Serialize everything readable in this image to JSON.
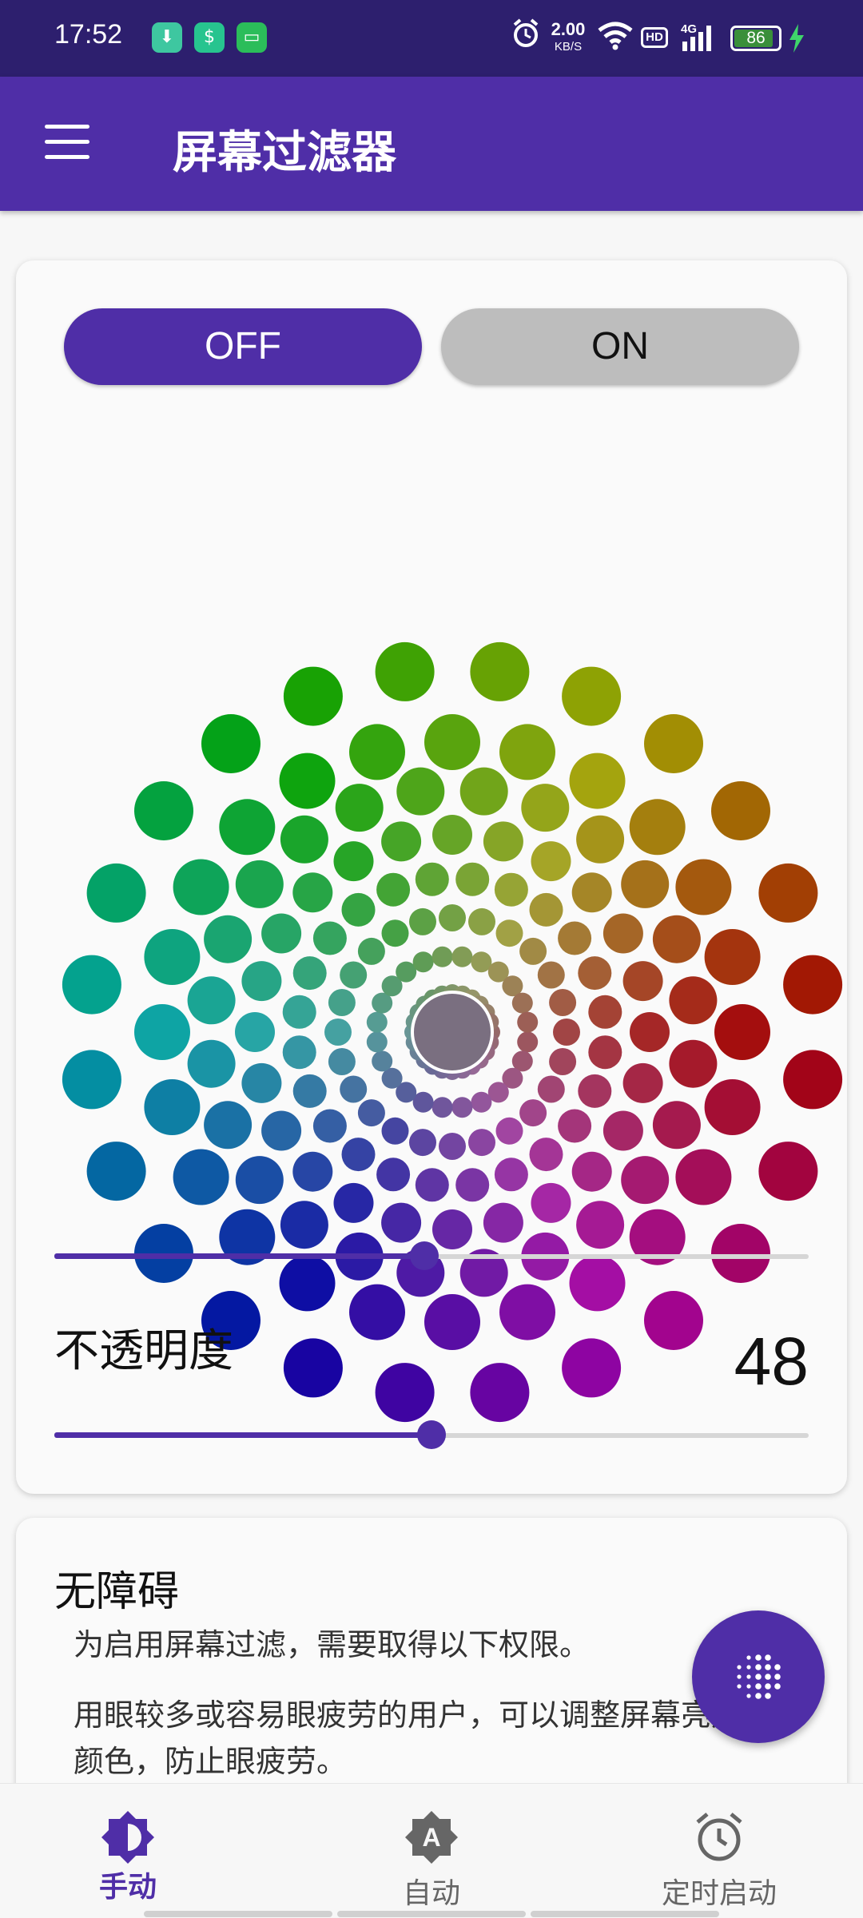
{
  "status_bar": {
    "time": "17:52",
    "app_icons": [
      "download-icon",
      "shield-icon",
      "message-icon"
    ],
    "net_speed": "2.00",
    "net_unit": "KB/S",
    "hd": "HD",
    "network": "4G",
    "battery": "86"
  },
  "app_bar": {
    "title": "屏幕过滤器"
  },
  "filter_card": {
    "toggle_off": "OFF",
    "toggle_on": "ON",
    "color_slider_fraction": 0.49,
    "opacity_label": "不透明度",
    "opacity_value": "48",
    "opacity_fraction": 0.5
  },
  "accessibility_card": {
    "title": "无障碍",
    "text1": "为启用屏幕过滤，需要取得以下权限。",
    "text2": "用眼较多或容易眼疲劳的用户，可以调整屏幕亮度与颜色，防止眼疲劳。"
  },
  "bottom_nav": {
    "items": [
      {
        "label": "手动",
        "icon": "brightness-icon",
        "active": true
      },
      {
        "label": "自动",
        "icon": "auto-brightness-icon",
        "active": false
      },
      {
        "label": "定时启动",
        "icon": "alarm-clock-icon",
        "active": false
      }
    ]
  },
  "colors": {
    "accent": "#4f2ea7",
    "status_bar": "#2d1f6e",
    "toggle_inactive": "#bdbdbd"
  }
}
